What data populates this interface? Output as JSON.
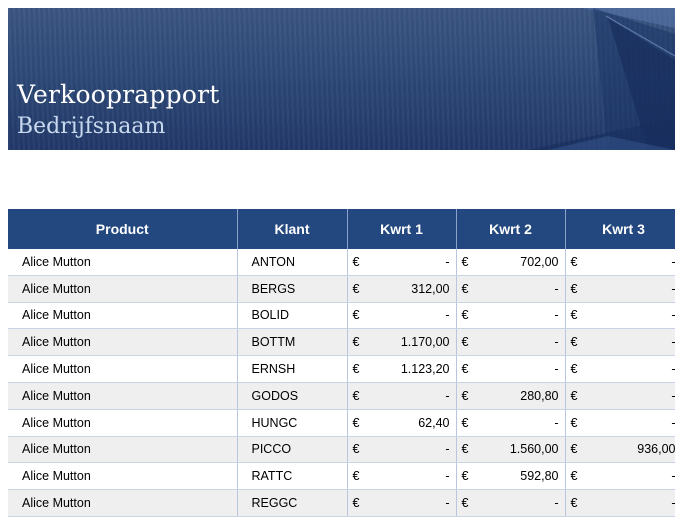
{
  "header": {
    "title": "Verkooprapport",
    "subtitle": "Bedrijfsnaam"
  },
  "table": {
    "columns": [
      "Product",
      "Klant",
      "Kwrt 1",
      "Kwrt 2",
      "Kwrt 3"
    ],
    "currency": "€",
    "rows": [
      {
        "product": "Alice Mutton",
        "klant": "ANTON",
        "q1": "-",
        "q2": "702,00",
        "q3": "-"
      },
      {
        "product": "Alice Mutton",
        "klant": "BERGS",
        "q1": "312,00",
        "q2": "-",
        "q3": "-"
      },
      {
        "product": "Alice Mutton",
        "klant": "BOLID",
        "q1": "-",
        "q2": "-",
        "q3": "-"
      },
      {
        "product": "Alice Mutton",
        "klant": "BOTTM",
        "q1": "1.170,00",
        "q2": "-",
        "q3": "-"
      },
      {
        "product": "Alice Mutton",
        "klant": "ERNSH",
        "q1": "1.123,20",
        "q2": "-",
        "q3": "-"
      },
      {
        "product": "Alice Mutton",
        "klant": "GODOS",
        "q1": "-",
        "q2": "280,80",
        "q3": "-"
      },
      {
        "product": "Alice Mutton",
        "klant": "HUNGC",
        "q1": "62,40",
        "q2": "-",
        "q3": "-"
      },
      {
        "product": "Alice Mutton",
        "klant": "PICCO",
        "q1": "-",
        "q2": "1.560,00",
        "q3": "936,00"
      },
      {
        "product": "Alice Mutton",
        "klant": "RATTC",
        "q1": "-",
        "q2": "592,80",
        "q3": "-"
      },
      {
        "product": "Alice Mutton",
        "klant": "REGGC",
        "q1": "-",
        "q2": "-",
        "q3": "-"
      }
    ]
  }
}
